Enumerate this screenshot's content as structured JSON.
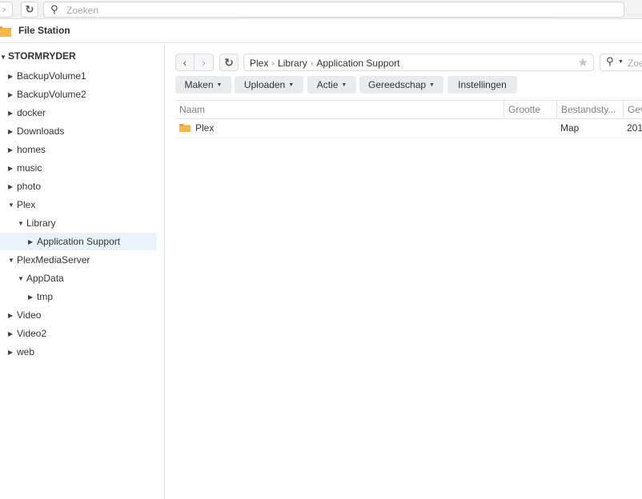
{
  "browser": {
    "search_placeholder": "Zoeken"
  },
  "app": {
    "title": "File Station"
  },
  "sidebar": {
    "root": "STORMRYDER",
    "items": [
      {
        "label": "BackupVolume1"
      },
      {
        "label": "BackupVolume2"
      },
      {
        "label": "docker"
      },
      {
        "label": "Downloads"
      },
      {
        "label": "homes"
      },
      {
        "label": "music"
      },
      {
        "label": "photo"
      },
      {
        "label": "Plex"
      },
      {
        "label": "Library"
      },
      {
        "label": "Application Support"
      },
      {
        "label": "PlexMediaServer"
      },
      {
        "label": "AppData"
      },
      {
        "label": "tmp"
      },
      {
        "label": "Video"
      },
      {
        "label": "Video2"
      },
      {
        "label": "web"
      }
    ]
  },
  "pathbar": {
    "crumbs": [
      "Plex",
      "Library",
      "Application Support"
    ],
    "search_placeholder": "Zoe"
  },
  "toolbar": {
    "create": "Maken",
    "upload": "Uploaden",
    "action": "Actie",
    "tools": "Gereedschap",
    "settings": "Instellingen"
  },
  "grid": {
    "columns": [
      "Naam",
      "Grootte",
      "Bestandsty...",
      "Gev"
    ],
    "rows": [
      {
        "name": "Plex",
        "size": "",
        "type": "Map",
        "modified": "201"
      }
    ]
  },
  "colors": {
    "folder": "#f5a623",
    "selected_bg": "#eaf2fb",
    "button_bg": "#e9ecef"
  }
}
